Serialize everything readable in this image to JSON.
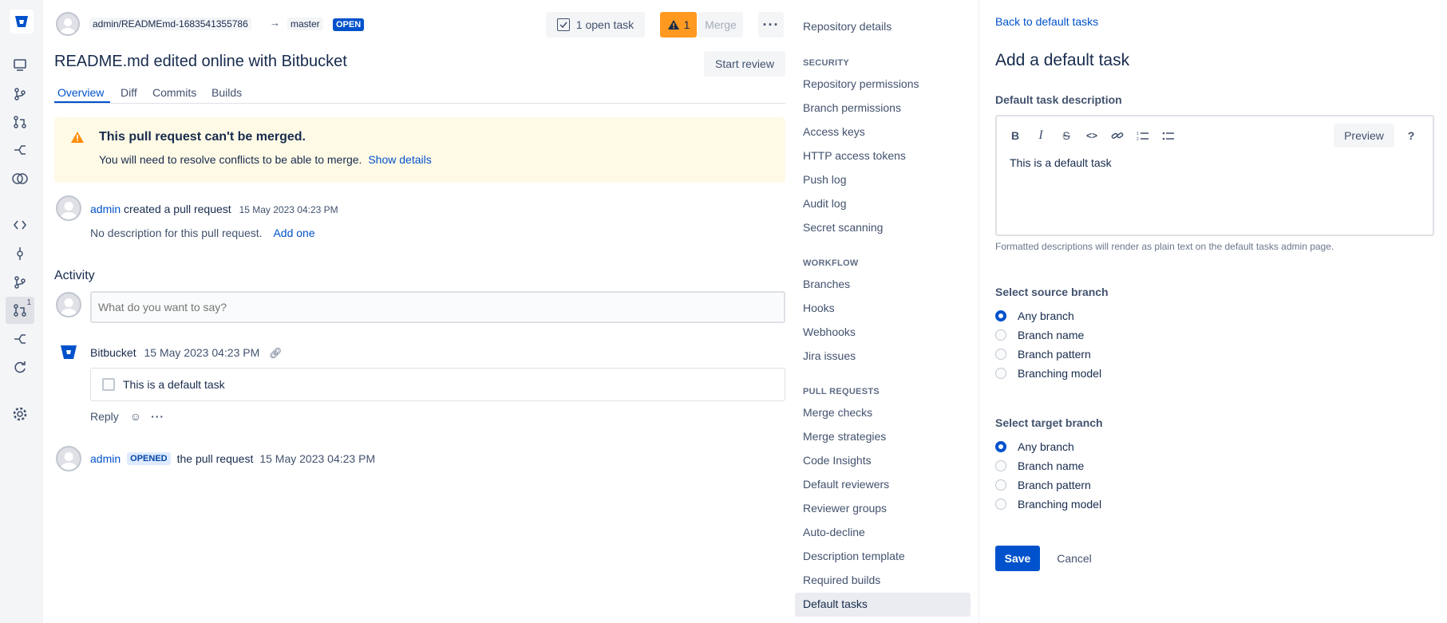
{
  "global_nav": {
    "items": [
      "commits-icon",
      "branches-icon",
      "pull-requests-icon",
      "compare-icon",
      "hashtag-icon",
      "source-icon",
      "commit-icon",
      "branch-icon",
      "pull-request-icon",
      "compare2-icon",
      "sync-icon",
      "settings-icon"
    ],
    "pr_badge": "1"
  },
  "pr": {
    "source_branch": "admin/READMEmd-1683541355786",
    "target_branch": "master",
    "status": "OPEN",
    "open_tasks": "1 open task",
    "warning_count": "1",
    "merge_label": "Merge",
    "title": "README.md edited online with Bitbucket",
    "start_review": "Start review",
    "tabs": [
      "Overview",
      "Diff",
      "Commits",
      "Builds"
    ],
    "alert": {
      "title": "This pull request can't be merged.",
      "body": "You will need to resolve conflicts to be able to merge.",
      "link": "Show details"
    },
    "created": {
      "user": "admin",
      "action": "created a pull request",
      "time": "15 May 2023 04:23 PM",
      "desc": "No description for this pull request.",
      "add": "Add one"
    },
    "activity_heading": "Activity",
    "comment_placeholder": "What do you want to say?",
    "task_comment": {
      "author": "Bitbucket",
      "time": "15 May 2023 04:23 PM",
      "task": "This is a default task",
      "reply": "Reply"
    },
    "opened": {
      "user": "admin",
      "badge": "OPENED",
      "text": "the pull request",
      "time": "15 May 2023 04:23 PM"
    }
  },
  "settings_nav": {
    "repo_details": "Repository details",
    "security_heading": "SECURITY",
    "security": [
      "Repository permissions",
      "Branch permissions",
      "Access keys",
      "HTTP access tokens",
      "Push log",
      "Audit log",
      "Secret scanning"
    ],
    "workflow_heading": "WORKFLOW",
    "workflow": [
      "Branches",
      "Hooks",
      "Webhooks",
      "Jira issues"
    ],
    "pr_heading": "PULL REQUESTS",
    "pull_requests": [
      "Merge checks",
      "Merge strategies",
      "Code Insights",
      "Default reviewers",
      "Reviewer groups",
      "Auto-decline",
      "Description template",
      "Required builds",
      "Default tasks"
    ]
  },
  "panel": {
    "back": "Back to default tasks",
    "title": "Add a default task",
    "desc_label": "Default task description",
    "preview": "Preview",
    "help": "?",
    "editor_text": "This is a default task",
    "help_text": "Formatted descriptions will render as plain text on the default tasks admin page.",
    "source_label": "Select source branch",
    "source_options": [
      "Any branch",
      "Branch name",
      "Branch pattern",
      "Branching model"
    ],
    "target_label": "Select target branch",
    "target_options": [
      "Any branch",
      "Branch name",
      "Branch pattern",
      "Branching model"
    ],
    "save": "Save",
    "cancel": "Cancel"
  },
  "colors": {
    "accent": "#0052cc",
    "warning": "#ff991f",
    "alert_bg": "#fffae6"
  }
}
